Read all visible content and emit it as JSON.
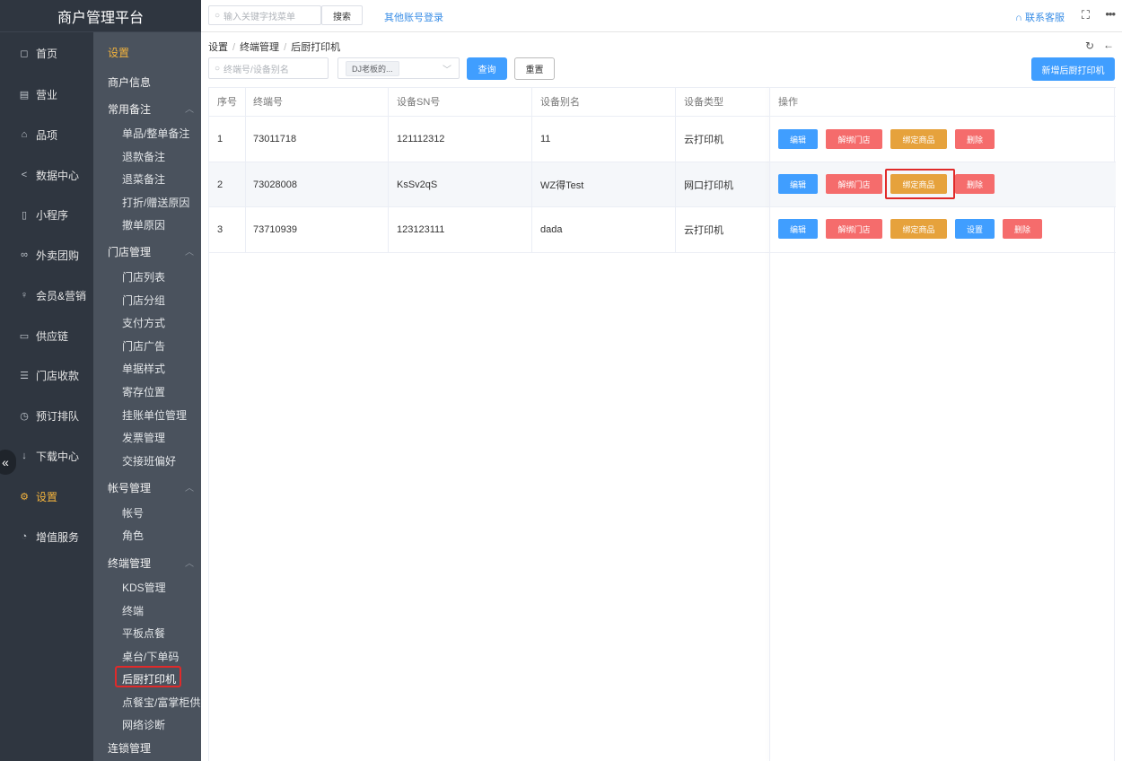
{
  "app": {
    "title": "商户管理平台"
  },
  "topbar": {
    "search_placeholder": "输入关键字找菜单",
    "search_button": "搜索",
    "other_login": "其他账号登录",
    "support": "联系客服"
  },
  "left_nav": {
    "items": [
      {
        "label": "首页",
        "icon": "home-icon",
        "glyph": "◻"
      },
      {
        "label": "营业",
        "icon": "calendar-icon",
        "glyph": "▤"
      },
      {
        "label": "品项",
        "icon": "bag-icon",
        "glyph": "⌂"
      },
      {
        "label": "数据中心",
        "icon": "share-icon",
        "glyph": "<"
      },
      {
        "label": "小程序",
        "icon": "phone-icon",
        "glyph": "▯"
      },
      {
        "label": "外卖团购",
        "icon": "bike-icon",
        "glyph": "∞"
      },
      {
        "label": "会员&营销",
        "icon": "user-icon",
        "glyph": "♀"
      },
      {
        "label": "供应链",
        "icon": "truck-icon",
        "glyph": "▭"
      },
      {
        "label": "门店收款",
        "icon": "coins-icon",
        "glyph": "☰"
      },
      {
        "label": "预订排队",
        "icon": "clock-icon",
        "glyph": "◷"
      },
      {
        "label": "下载中心",
        "icon": "download-icon",
        "glyph": "↓"
      },
      {
        "label": "设置",
        "icon": "gear-icon",
        "glyph": "⚙",
        "active": true
      },
      {
        "label": "增值服务",
        "icon": "alarm-icon",
        "glyph": "◔"
      }
    ]
  },
  "sub_nav": {
    "title": "设置",
    "merchant_info": "商户信息",
    "group_common": "常用备注",
    "common_items": [
      "单品/整单备注",
      "退款备注",
      "退菜备注",
      "打折/赠送原因",
      "撤单原因"
    ],
    "group_store": "门店管理",
    "store_items": [
      "门店列表",
      "门店分组",
      "支付方式",
      "门店广告",
      "单据样式",
      "寄存位置",
      "挂账单位管理",
      "发票管理",
      "交接班偏好"
    ],
    "group_account": "帐号管理",
    "account_items": [
      "帐号",
      "角色"
    ],
    "group_terminal": "终端管理",
    "terminal_items": [
      "KDS管理",
      "终端",
      "平板点餐",
      "桌台/下单码",
      "后厨打印机",
      "点餐宝/富掌柜供应",
      "网络诊断"
    ],
    "group_chain": "连锁管理"
  },
  "breadcrumb": [
    "设置",
    "终端管理",
    "后厨打印机"
  ],
  "filters": {
    "input_placeholder": "终端号/设备别名",
    "select_tag": "DJ老板的...",
    "query_button": "查询",
    "reset_button": "重置",
    "add_button": "新增后厨打印机"
  },
  "table": {
    "headers": [
      "序号",
      "终端号",
      "设备SN号",
      "设备别名",
      "设备类型",
      "操作"
    ],
    "rows": [
      {
        "index": "1",
        "terminal": "73011718",
        "sn": "121112312",
        "alias": "11",
        "type": "云打印机"
      },
      {
        "index": "2",
        "terminal": "73028008",
        "sn": "KsSv2qS",
        "alias": "WZ得Test",
        "type": "网口打印机"
      },
      {
        "index": "3",
        "terminal": "73710939",
        "sn": "123123111",
        "alias": "dada",
        "type": "云打印机"
      }
    ],
    "actions": {
      "edit": "编辑",
      "unbind_store": "解绑门店",
      "bind_goods": "绑定商品",
      "settings": "设置",
      "delete": "删除"
    }
  },
  "colors": {
    "accent": "#409eff",
    "danger": "#f56c6c",
    "warning": "#e6a23c",
    "active_nav": "#f3b33d",
    "highlight": "#e02a2a"
  }
}
